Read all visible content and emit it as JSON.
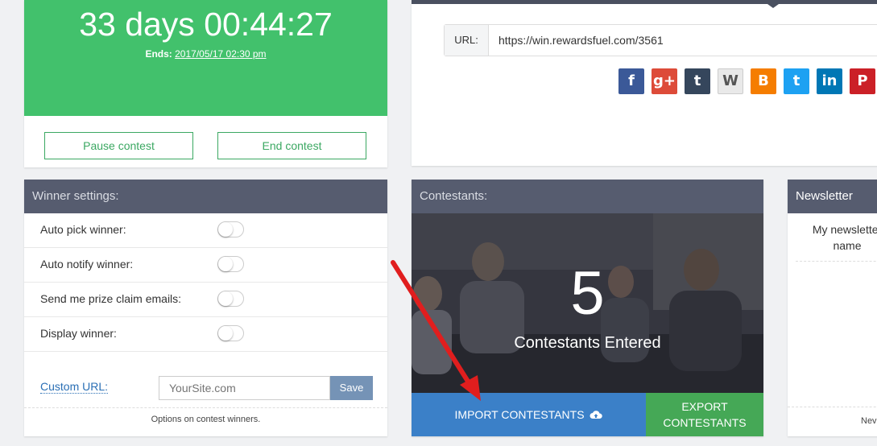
{
  "timer": {
    "countdown": "33 days 00:44:27",
    "ends_label": "Ends:",
    "ends_date": "2017/05/17 02:30 pm",
    "pause_label": "Pause contest",
    "end_label": "End contest",
    "color": "#42c16c"
  },
  "share": {
    "url_label": "URL:",
    "url_value": "https://win.rewardsfuel.com/3561",
    "social": [
      {
        "name": "facebook-icon",
        "glyph": "f",
        "color": "#3b5998"
      },
      {
        "name": "google-plus-icon",
        "glyph": "g+",
        "color": "#dd4b39"
      },
      {
        "name": "tumblr-icon",
        "glyph": "t",
        "color": "#35465c"
      },
      {
        "name": "wordpress-icon",
        "glyph": "W",
        "color": "#e9e9e9"
      },
      {
        "name": "blogger-icon",
        "glyph": "B",
        "color": "#f57d00"
      },
      {
        "name": "twitter-icon",
        "glyph": "t",
        "color": "#1da1f2"
      },
      {
        "name": "linkedin-icon",
        "glyph": "in",
        "color": "#0077b5"
      },
      {
        "name": "pinterest-icon",
        "glyph": "P",
        "color": "#cb2027"
      }
    ]
  },
  "winner": {
    "header": "Winner settings:",
    "rows": [
      {
        "label": "Auto pick winner:",
        "enabled": false
      },
      {
        "label": "Auto notify winner:",
        "enabled": false
      },
      {
        "label": "Send me prize claim emails:",
        "enabled": false
      },
      {
        "label": "Display winner:",
        "enabled": false
      }
    ],
    "custom_url_label": "Custom URL:",
    "custom_url_placeholder": "YourSite.com",
    "save_label": "Save",
    "footer": "Options on contest winners."
  },
  "contestants": {
    "header": "Contestants:",
    "count": "5",
    "count_label": "Contestants Entered",
    "import_label": "IMPORT CONTESTANTS",
    "import_icon": "cloud-upload-icon",
    "export_label_1": "EXPORT",
    "export_label_2": "CONTESTANTS"
  },
  "newsletter": {
    "header": "Newsletter",
    "label_1": "My newsletter",
    "label_2": "name",
    "footer": "Nev"
  }
}
